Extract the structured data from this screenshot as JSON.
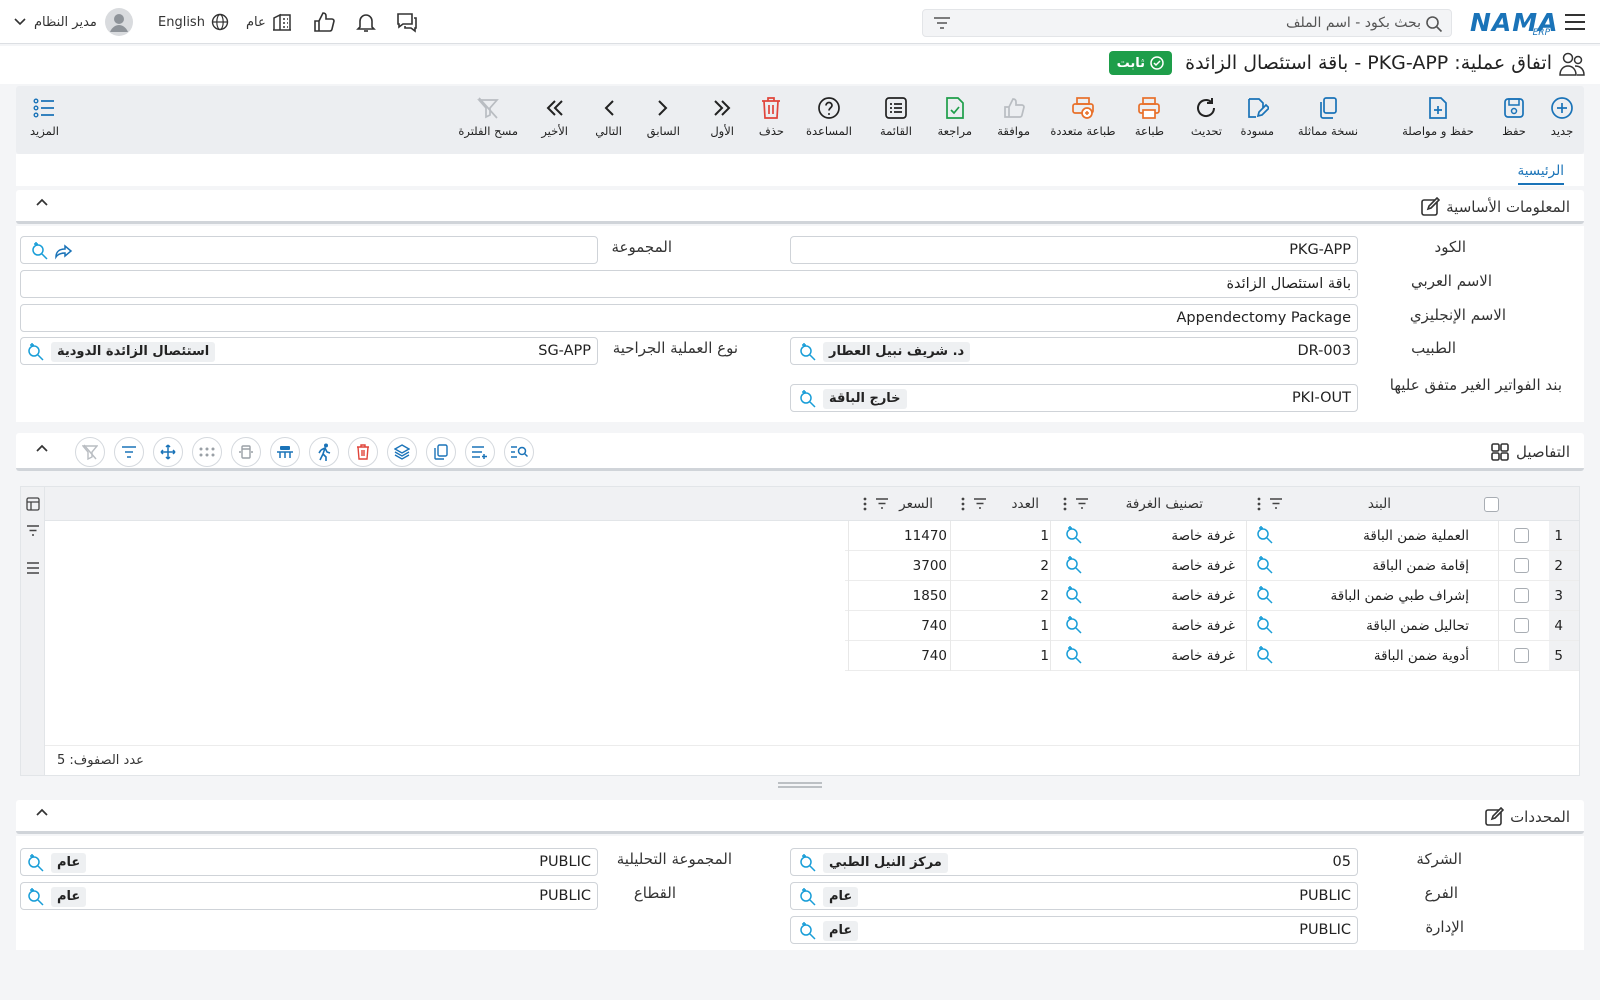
{
  "topbar": {
    "brand_main": "NAMA",
    "brand_sub": "ERP",
    "search_placeholder": "بحث بكود - اسم الملف",
    "user_name": "مدير النظام",
    "language": "English",
    "branch": "عام"
  },
  "page": {
    "title": "اتفاق عملية: PKG-APP - باقة استئصال الزائدة",
    "status": "ثابت"
  },
  "toolbar": {
    "new": "جديد",
    "save": "حفظ",
    "save_continue": "حفظ و مواصلة",
    "duplicate": "نسخة مماثلة",
    "draft": "مسودة",
    "refresh": "تحديث",
    "print": "طباعة",
    "multi_print": "طباعة متعددة",
    "approve": "موافقة",
    "review": "مراجعة",
    "list": "القائمة",
    "help": "المساعدة",
    "delete": "حذف",
    "first": "الأول",
    "previous": "السابق",
    "next": "التالي",
    "last": "الأخير",
    "clear_filter": "مسح الفلترة",
    "more": "المزيد"
  },
  "tabs": {
    "main": "الرئيسية"
  },
  "basic_info": {
    "section_title": "المعلومات الأساسية",
    "code_label": "الكود",
    "code_value": "PKG-APP",
    "group_label": "المجموعة",
    "group_value": "",
    "arabic_name_label": "الاسم العربي",
    "arabic_name_value": "باقة استئصال الزائدة",
    "english_name_label": "الاسم الإنجليزي",
    "english_name_value": "Appendectomy Package",
    "doctor_label": "الطبيب",
    "doctor_code": "DR-003",
    "doctor_name": "د. شريف نبيل العطار",
    "surgery_type_label": "نوع العملية الجراحية",
    "surgery_type_code": "SG-APP",
    "surgery_type_name": "استئصال الزائدة الدودية",
    "unagreed_invoice_label": "بند الفواتير الغير متفق عليها",
    "unagreed_invoice_code": "PKI-OUT",
    "unagreed_invoice_name": "خارج الباقة"
  },
  "details": {
    "section_title": "التفاصيل",
    "columns": {
      "item": "البند",
      "room_class": "تصنيف الغرفة",
      "count": "العدد",
      "price": "السعر"
    },
    "rows": [
      {
        "num": "1",
        "item": "العملية ضمن الباقة",
        "room_class": "غرفة خاصة",
        "count": "1",
        "price": "11470"
      },
      {
        "num": "2",
        "item": "إقامة ضمن الباقة",
        "room_class": "غرفة خاصة",
        "count": "2",
        "price": "3700"
      },
      {
        "num": "3",
        "item": "إشراف طبي ضمن الباقة",
        "room_class": "غرفة خاصة",
        "count": "2",
        "price": "1850"
      },
      {
        "num": "4",
        "item": "تحاليل ضمن الباقة",
        "room_class": "غرفة خاصة",
        "count": "1",
        "price": "740"
      },
      {
        "num": "5",
        "item": "أدوية ضمن الباقة",
        "room_class": "غرفة خاصة",
        "count": "1",
        "price": "740"
      }
    ],
    "row_count": "عدد الصفوف: 5"
  },
  "dimensions": {
    "section_title": "المحددات",
    "company_label": "الشركة",
    "company_code": "05",
    "company_name": "مركز النيل الطبي",
    "analytic_group_label": "المجموعة التحليلية",
    "analytic_group_code": "PUBLIC",
    "analytic_group_name": "عام",
    "branch_label": "الفرع",
    "branch_code": "PUBLIC",
    "branch_name": "عام",
    "sector_label": "القطاع",
    "sector_code": "PUBLIC",
    "sector_name": "عام",
    "department_label": "الإدارة",
    "department_code": "PUBLIC",
    "department_name": "عام"
  },
  "colors": {
    "accent": "#1a73b8",
    "status_green": "#1e9e4a",
    "danger": "#e0443a",
    "print_orange": "#e8702a"
  }
}
